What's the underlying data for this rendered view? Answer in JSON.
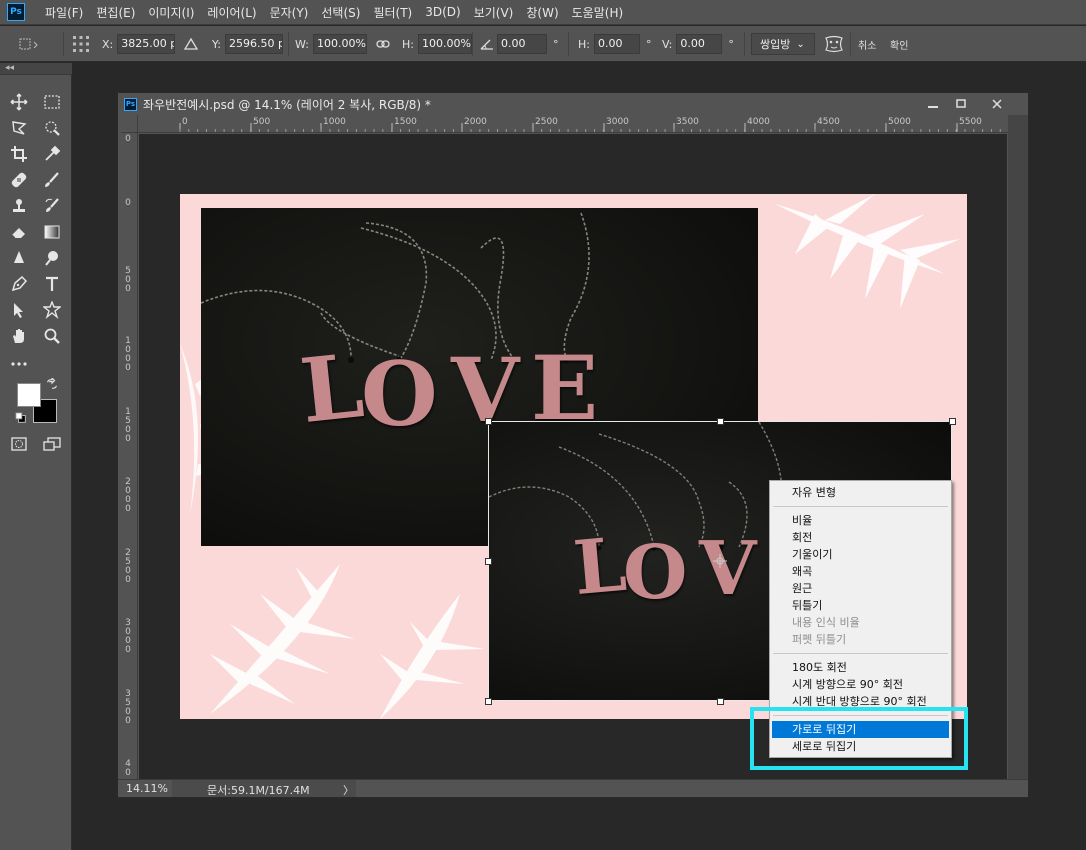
{
  "menubar": {
    "app_icon": "Ps",
    "items": [
      "파일(F)",
      "편집(E)",
      "이미지(I)",
      "레이어(L)",
      "문자(Y)",
      "선택(S)",
      "필터(T)",
      "3D(D)",
      "보기(V)",
      "창(W)",
      "도움말(H)"
    ]
  },
  "options": {
    "x_label": "X:",
    "x_value": "3825.00 px",
    "y_label": "Y:",
    "y_value": "2596.50 px",
    "w_label": "W:",
    "w_value": "100.00%",
    "h_label": "H:",
    "h_value": "100.00%",
    "angle_value": "0.00",
    "angle_unit": "°",
    "hskew_label": "H:",
    "hskew_value": "0.00",
    "hskew_unit": "°",
    "vskew_label": "V:",
    "vskew_value": "0.00",
    "vskew_unit": "°",
    "interpolation": "쌍입방",
    "cancel_label": "취소",
    "commit_label": "확인"
  },
  "panel_strip": {
    "collapse": "◂◂"
  },
  "document": {
    "app_icon": "Ps",
    "title": "좌우반전예시.psd @ 14.1% (레이어 2 복사, RGB/8) *",
    "h_ruler_labels": [
      "0",
      "500",
      "1000",
      "1500",
      "2000",
      "2500",
      "3000",
      "3500",
      "4000",
      "4500",
      "5000",
      "5500"
    ],
    "v_ruler_labels": [
      "0",
      "0",
      "5\n0\n0",
      "1\n0\n0\n0",
      "1\n5\n0\n0",
      "2\n0\n0\n0",
      "2\n5\n0\n0",
      "3\n0\n0\n0",
      "3\n5\n0\n0",
      "4\n0"
    ],
    "zoom": "14.11%",
    "doc_size": "문서:59.1M/167.4M",
    "status_arrow": "〉"
  },
  "canvas": {
    "photo1_letters": [
      "L",
      "O",
      "V",
      "E"
    ],
    "photo2_letters": [
      "L",
      "O",
      "V"
    ]
  },
  "context_menu": {
    "items": [
      {
        "label": "자유 변형",
        "state": "normal"
      },
      {
        "label": "비율",
        "state": "normal"
      },
      {
        "label": "회전",
        "state": "normal"
      },
      {
        "label": "기울이기",
        "state": "normal"
      },
      {
        "label": "왜곡",
        "state": "normal"
      },
      {
        "label": "원근",
        "state": "normal"
      },
      {
        "label": "뒤틀기",
        "state": "normal"
      },
      {
        "label": "내용 인식 비율",
        "state": "disabled"
      },
      {
        "label": "퍼펫 뒤틀기",
        "state": "disabled"
      },
      {
        "label": "180도 회전",
        "state": "normal"
      },
      {
        "label": "시계 방향으로 90° 회전",
        "state": "normal"
      },
      {
        "label": "시계 반대 방향으로 90° 회전",
        "state": "normal"
      },
      {
        "label": "가로로 뒤집기",
        "state": "selected"
      },
      {
        "label": "세로로 뒤집기",
        "state": "normal"
      }
    ]
  },
  "colors": {
    "accent_highlight": "#27e2f1",
    "menu_selected": "#0078d7",
    "canvas_bg": "#fbd9d9",
    "letter_pink": "#c6898b"
  }
}
